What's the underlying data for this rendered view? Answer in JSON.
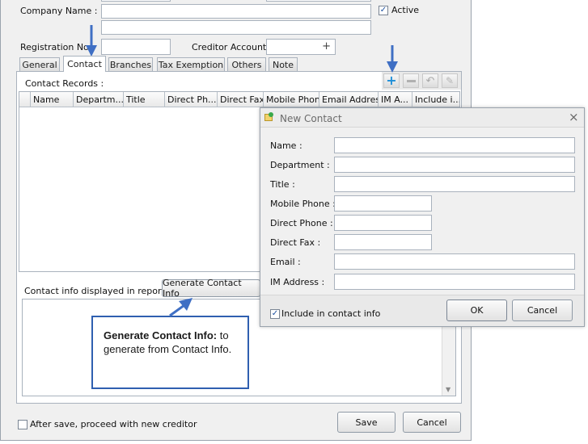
{
  "form": {
    "company_name_label": "Company Name :",
    "active_label": "Active",
    "active_checked": true,
    "registration_label": "Registration No.",
    "creditor_account_label": "Creditor Account :",
    "plus_glyph": "+"
  },
  "tabs": [
    {
      "label": "General"
    },
    {
      "label": "Contact",
      "active": true
    },
    {
      "label": "Branches"
    },
    {
      "label": "Tax Exemption"
    },
    {
      "label": "Others"
    },
    {
      "label": "Note"
    }
  ],
  "contact_panel": {
    "records_label": "Contact  Records :",
    "columns": [
      "Name",
      "Departm...",
      "Title",
      "Direct Ph...",
      "Direct Fax",
      "Mobile Phone",
      "Email Address",
      "IM A...",
      "Include i..."
    ],
    "report_label": "Contact info displayed in report :",
    "generate_button": "Generate Contact Info"
  },
  "toolbar_icons": [
    "plus-icon",
    "minus-icon",
    "undo-icon",
    "edit-icon"
  ],
  "callout": {
    "title": "Generate Contact Info:",
    "text": " to generate from Contact Info."
  },
  "footer": {
    "proceed_label": "After save, proceed with new creditor",
    "save": "Save",
    "cancel": "Cancel"
  },
  "dialog": {
    "title": "New Contact",
    "close_glyph": "×",
    "fields": {
      "name": "Name :",
      "department": "Department :",
      "title": "Title :",
      "mobile": "Mobile Phone :",
      "direct_phone": "Direct Phone :",
      "direct_fax": "Direct Fax :",
      "email": "Email :",
      "im": "IM Address :"
    },
    "include_label": "Include in contact info",
    "include_checked": true,
    "ok": "OK",
    "cancel": "Cancel"
  },
  "colors": {
    "arrow": "#3f6fc4",
    "callout_border": "#2f5fb0",
    "plus_icon": "#1f8fd8"
  }
}
